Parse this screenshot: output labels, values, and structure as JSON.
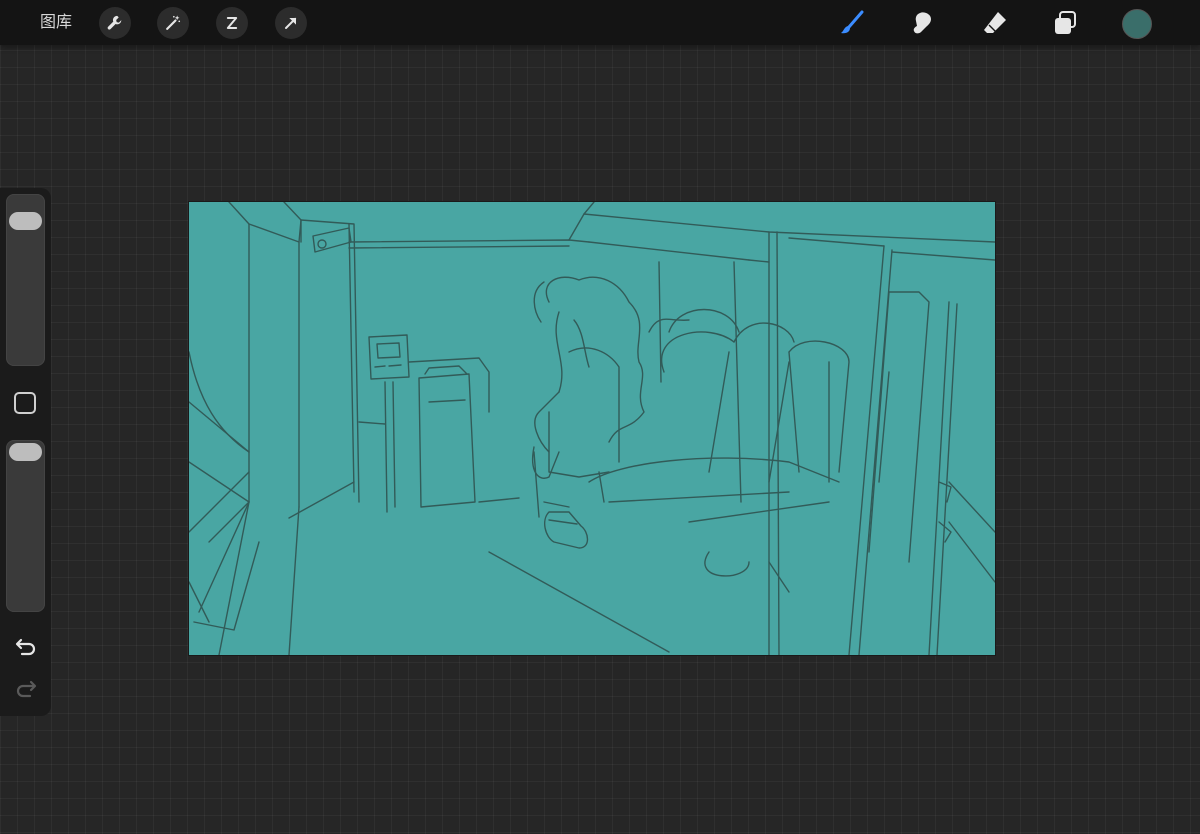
{
  "toolbar": {
    "gallery_label": "图库",
    "left_tools": [
      {
        "name": "actions",
        "icon": "wrench-icon"
      },
      {
        "name": "adjustments",
        "icon": "magic-wand-icon"
      },
      {
        "name": "selection",
        "icon": "selection-s-icon"
      },
      {
        "name": "transform",
        "icon": "arrow-cursor-icon"
      }
    ],
    "right_tools": [
      {
        "name": "brush",
        "icon": "brush-icon",
        "active": true
      },
      {
        "name": "smudge",
        "icon": "smudge-finger-icon",
        "active": false
      },
      {
        "name": "eraser",
        "icon": "eraser-icon",
        "active": false
      },
      {
        "name": "layers",
        "icon": "layers-icon",
        "active": false
      }
    ],
    "current_color": "#3a6e6a"
  },
  "sidebar": {
    "brush_size": 0.9,
    "opacity": 1.0,
    "modify_icon": "square-icon",
    "undo_icon": "undo-icon",
    "redo_icon": "redo-icon"
  },
  "canvas": {
    "background_color": "#49a6a3",
    "sketch_stroke_color": "#2e4e4c"
  },
  "colors": {
    "accent": "#3b8cff",
    "toolbar_bg": "#141414",
    "workspace_bg": "#262626"
  }
}
